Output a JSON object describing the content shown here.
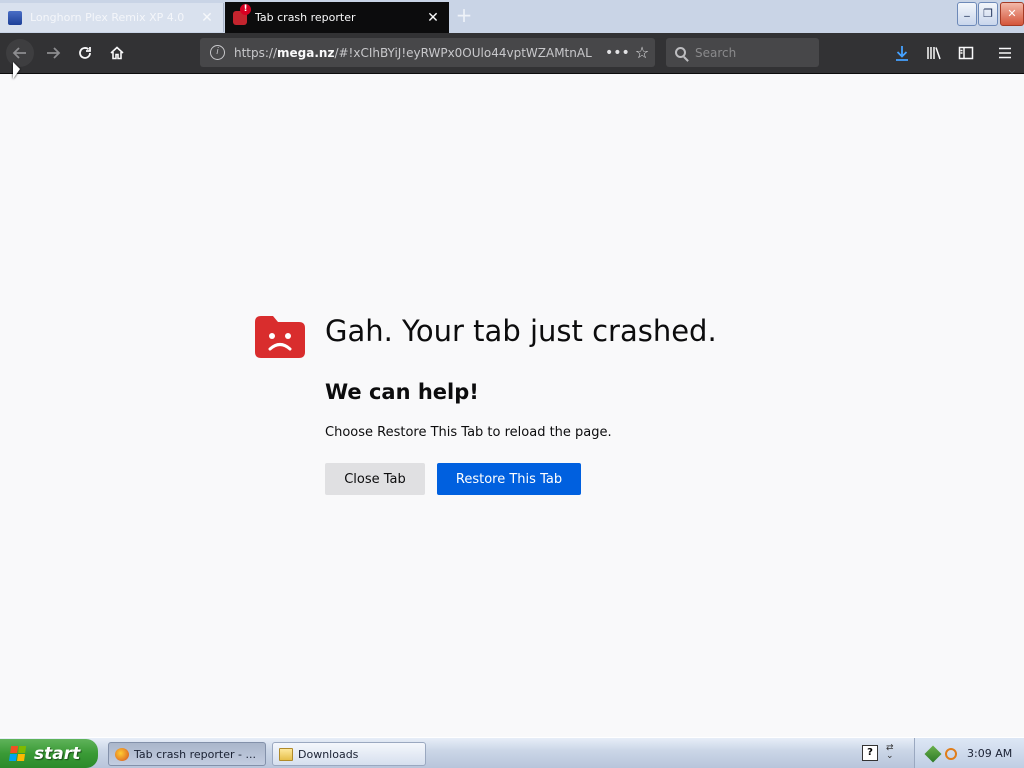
{
  "tabs": [
    {
      "title": "Longhorn Plex Remix XP 4.0",
      "active": false
    },
    {
      "title": "Tab crash reporter",
      "active": true
    }
  ],
  "window_controls": {
    "minimize": "_",
    "restore": "❐",
    "close": "✕"
  },
  "toolbar": {
    "url_prefix": "https://",
    "url_domain": "mega.nz",
    "url_path": "/#!xCIhBYiJ!eyRWPx0OUlo44vptWZAMtnAL",
    "search_placeholder": "Search"
  },
  "page": {
    "title": "Gah. Your tab just crashed.",
    "help_heading": "We can help!",
    "help_text": "Choose Restore This Tab to reload the page.",
    "close_tab_label": "Close Tab",
    "restore_label": "Restore This Tab"
  },
  "taskbar": {
    "start_label": "start",
    "tasks": [
      {
        "label": "Tab crash reporter - ...",
        "active": true
      },
      {
        "label": "Downloads",
        "active": false
      }
    ],
    "tray_help": "?",
    "clock": "3:09 AM"
  },
  "colors": {
    "restore_button": "#0060df",
    "close_button": "#e0e0e2",
    "sad_tab_icon": "#d92d2d",
    "toolbar_bg": "#323234",
    "download_arrow": "#45a1ff",
    "xp_start_green": "#3a9a36"
  }
}
